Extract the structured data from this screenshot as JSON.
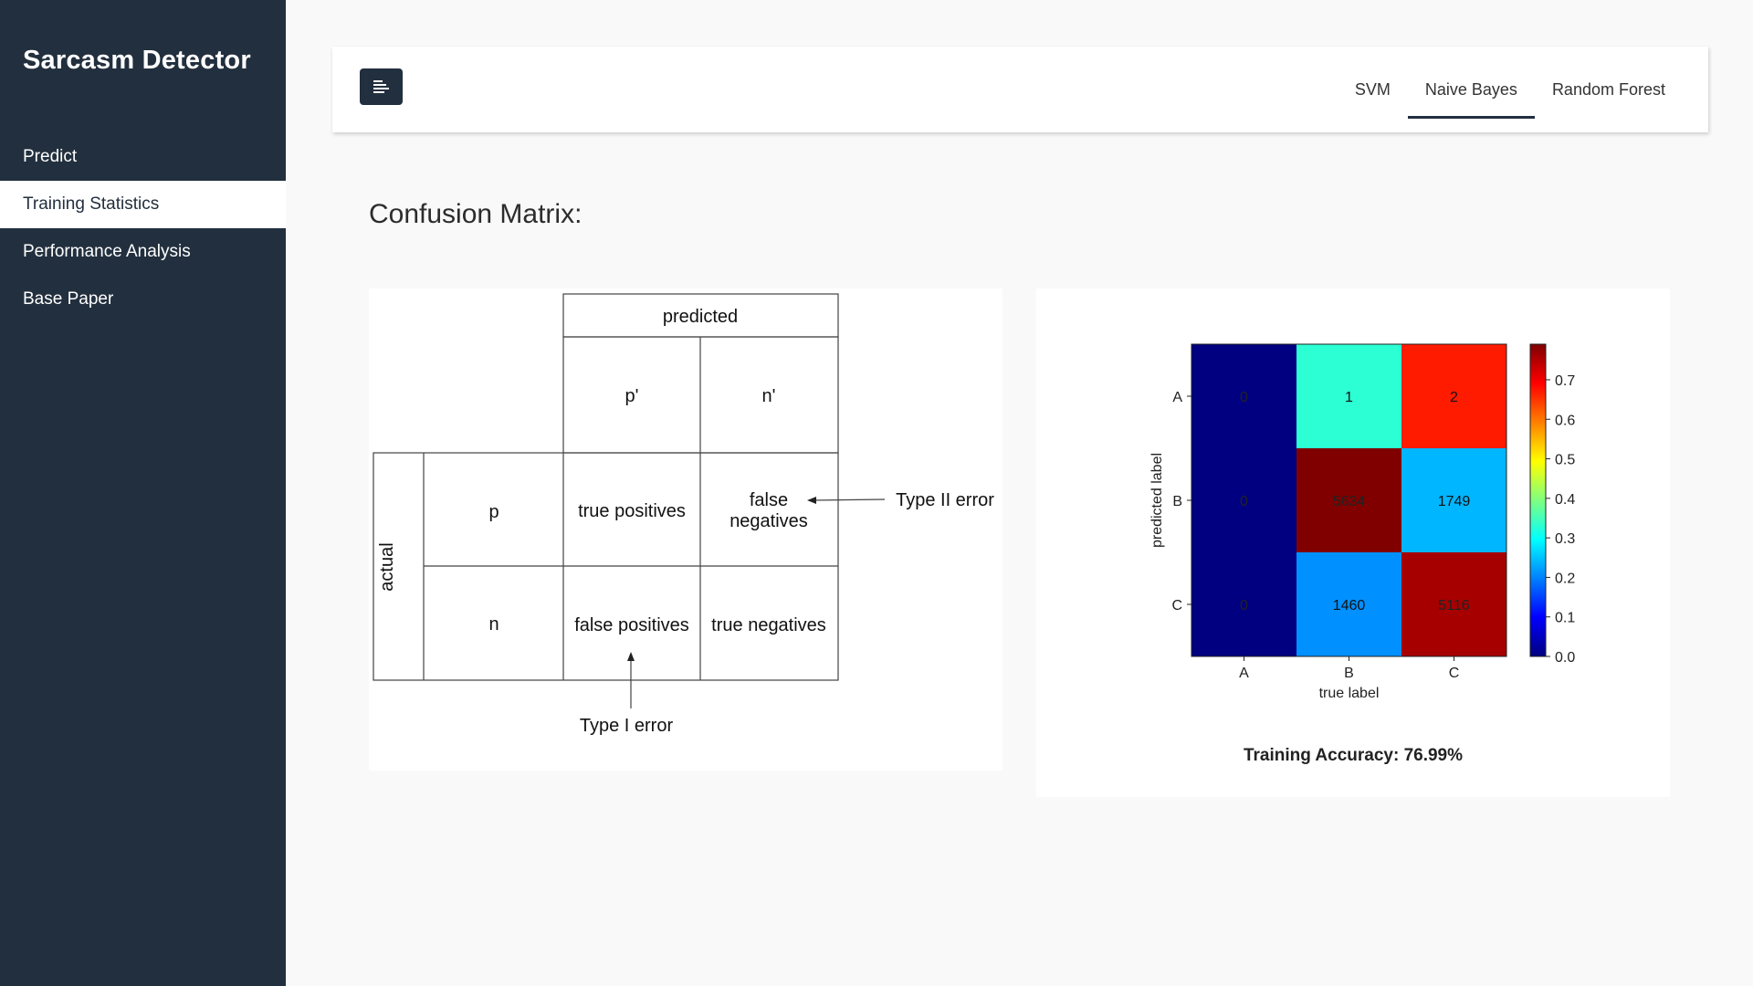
{
  "app": {
    "title": "Sarcasm Detector"
  },
  "sidebar": {
    "items": [
      {
        "label": "Predict",
        "active": false
      },
      {
        "label": "Training Statistics",
        "active": true
      },
      {
        "label": "Performance Analysis",
        "active": false
      },
      {
        "label": "Base Paper",
        "active": false
      }
    ]
  },
  "topbar": {
    "menu_icon": "align-left-icon",
    "tabs": [
      {
        "label": "SVM",
        "active": false
      },
      {
        "label": "Naive Bayes",
        "active": true
      },
      {
        "label": "Random Forest",
        "active": false
      }
    ]
  },
  "main": {
    "section_title": "Confusion Matrix:",
    "diagram": {
      "predicted": "predicted",
      "actual": "actual",
      "col_p": "p'",
      "col_n": "n'",
      "row_p": "p",
      "row_n": "n",
      "tp": "true positives",
      "fn_line1": "false",
      "fn_line2": "negatives",
      "fp": "false positives",
      "tn": "true negatives",
      "type2": "Type II error",
      "type1": "Type I error"
    },
    "accuracy": "Training Accuracy: 76.99%"
  },
  "chart_data": {
    "type": "heatmap",
    "x_categories": [
      "A",
      "B",
      "C"
    ],
    "y_categories": [
      "A",
      "B",
      "C"
    ],
    "xlabel": "true label",
    "ylabel": "predicted label",
    "cells": [
      [
        0,
        1,
        2
      ],
      [
        0,
        5634,
        1749
      ],
      [
        0,
        1460,
        5116
      ]
    ],
    "normalized": [
      [
        0.0,
        0.33,
        0.67
      ],
      [
        0.0,
        0.79,
        0.24
      ],
      [
        0.0,
        0.21,
        0.76
      ]
    ],
    "colormap": "jet",
    "colorbar": {
      "min": 0.0,
      "max": 0.79,
      "ticks": [
        "0.0",
        "0.1",
        "0.2",
        "0.3",
        "0.4",
        "0.5",
        "0.6",
        "0.7"
      ]
    }
  }
}
